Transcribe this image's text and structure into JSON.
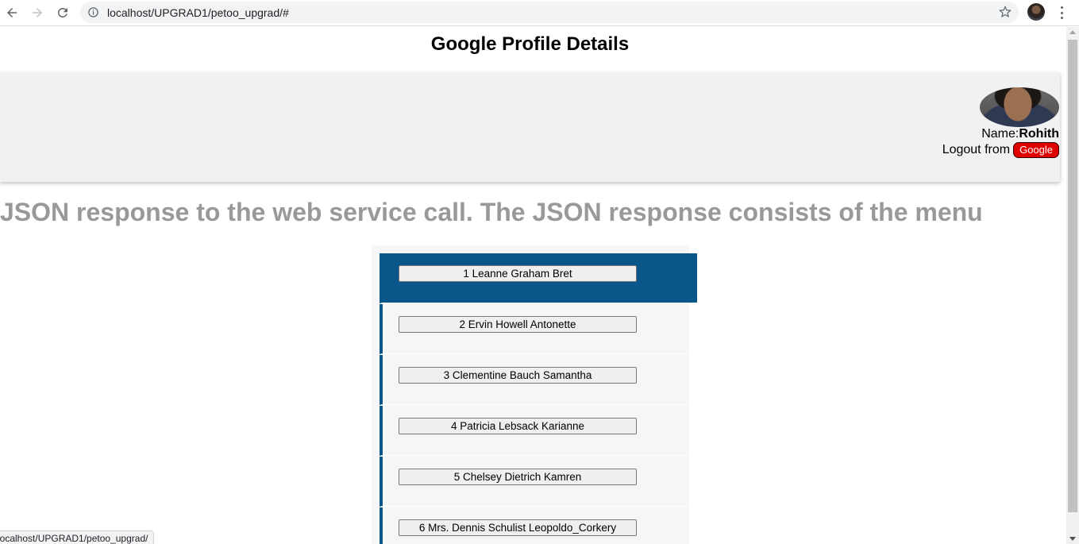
{
  "browser": {
    "url": "localhost/UPGRAD1/petoo_upgrad/#",
    "status_url": "localhost/UPGRAD1/petoo_upgrad/"
  },
  "page": {
    "title": "Google Profile Details",
    "heading": "JSON response to the web service call. The JSON response consists of the menu"
  },
  "profile": {
    "name_label": "Name:",
    "name_value": "Rohith",
    "logout_label": "Logout from",
    "google_button": "Google",
    "google_button_color": "#e00000"
  },
  "menu": {
    "accent_color": "#0a5689",
    "items": [
      {
        "label": "1 Leanne Graham Bret",
        "active": true
      },
      {
        "label": "2 Ervin Howell Antonette",
        "active": false
      },
      {
        "label": "3 Clementine Bauch Samantha",
        "active": false
      },
      {
        "label": "4 Patricia Lebsack Karianne",
        "active": false
      },
      {
        "label": "5 Chelsey Dietrich Kamren",
        "active": false
      },
      {
        "label": "6 Mrs. Dennis Schulist Leopoldo_Corkery",
        "active": false
      }
    ]
  }
}
